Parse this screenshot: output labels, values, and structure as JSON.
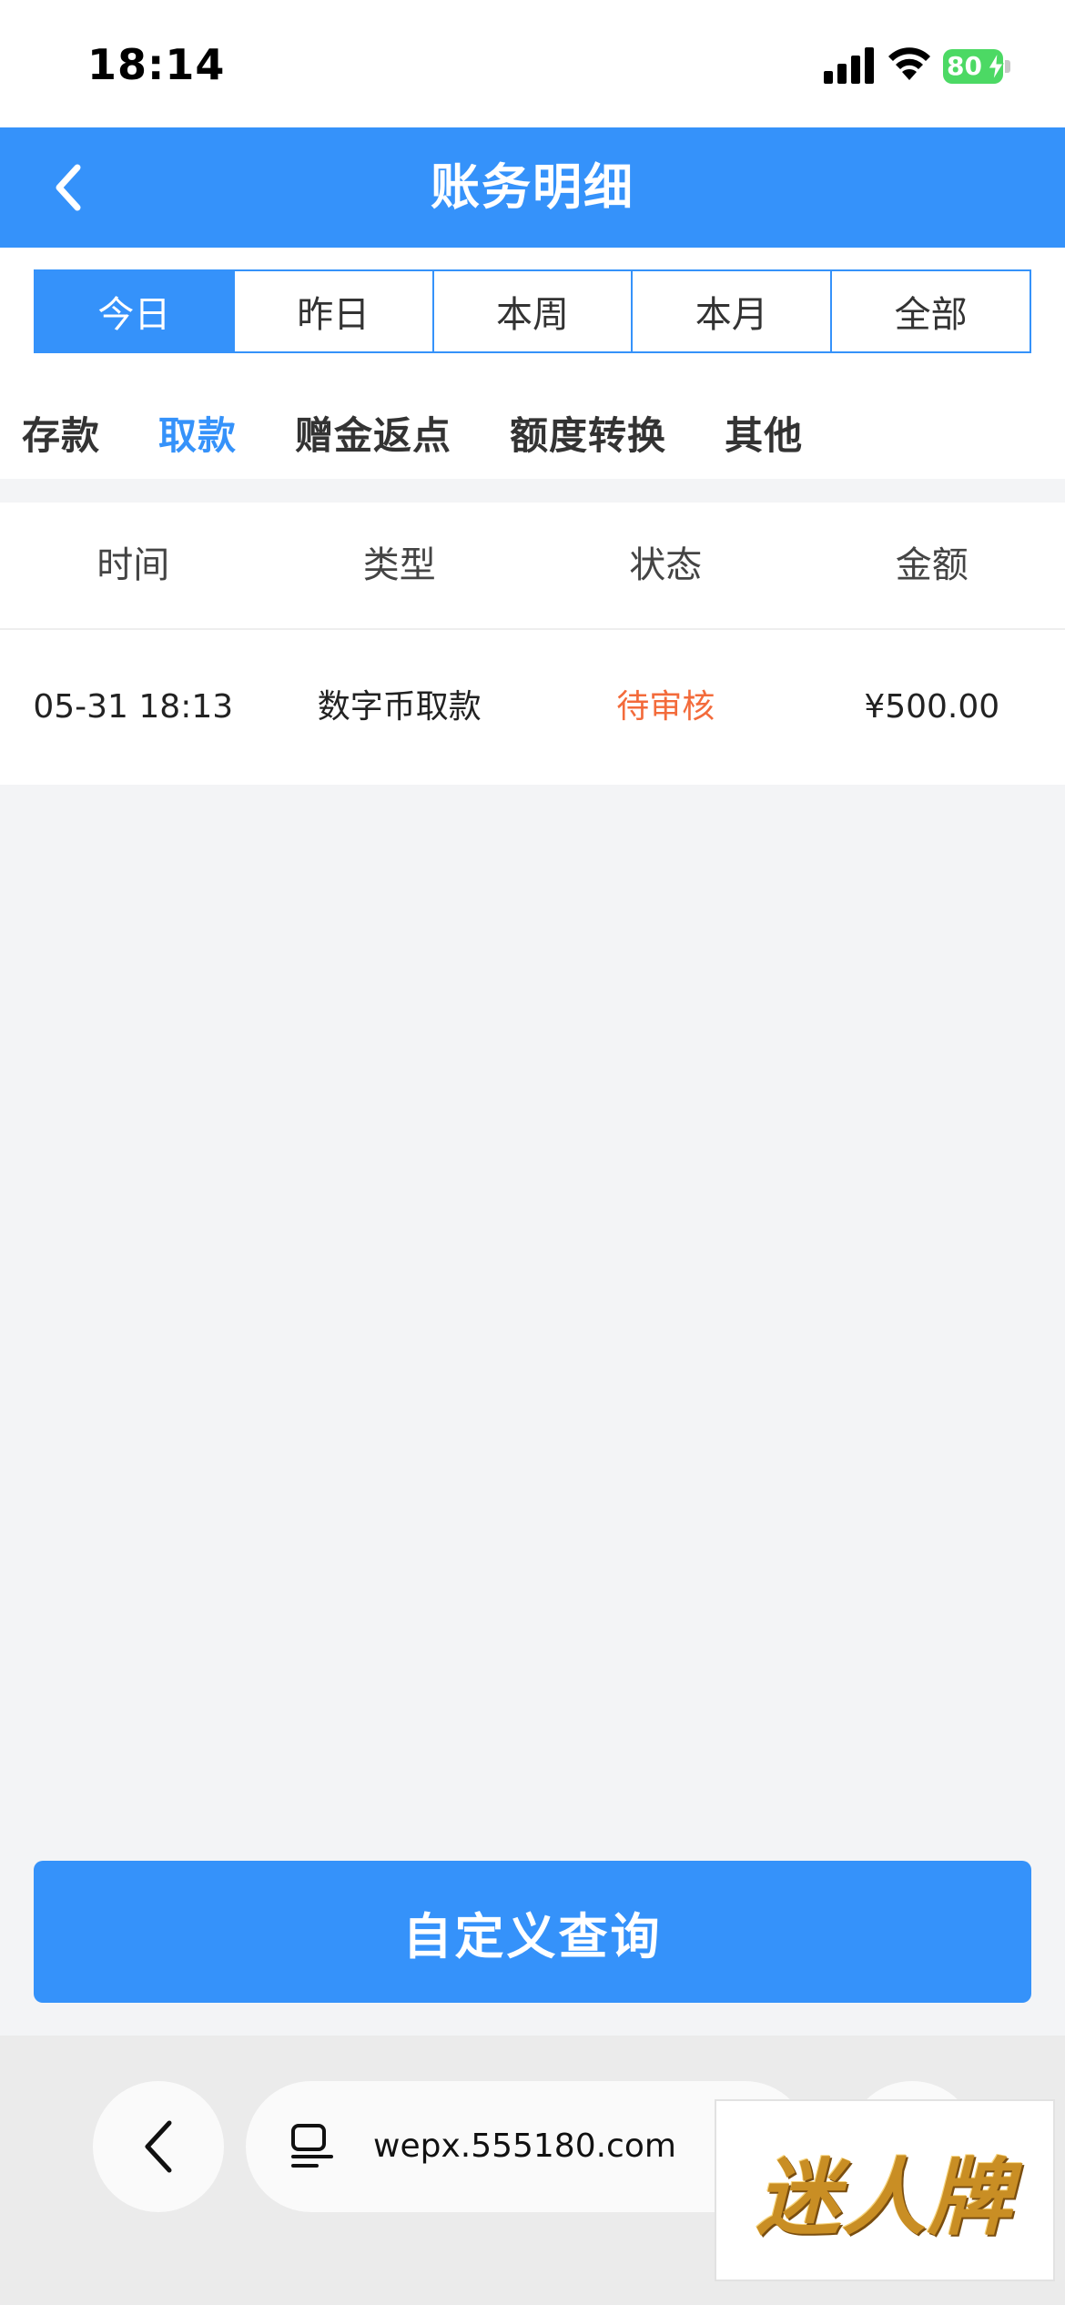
{
  "status_bar": {
    "time": "18:14",
    "battery": "80"
  },
  "header": {
    "title": "账务明细",
    "back_icon": "chevron-left-icon"
  },
  "period_filter": {
    "items": [
      "今日",
      "昨日",
      "本周",
      "本月",
      "全部"
    ],
    "active_index": 0
  },
  "type_tabs": {
    "items": [
      "存款",
      "取款",
      "赠金返点",
      "额度转换",
      "其他"
    ],
    "active_index": 1
  },
  "table": {
    "columns": [
      "时间",
      "类型",
      "状态",
      "金额"
    ],
    "rows": [
      {
        "time": "05-31 18:13",
        "type": "数字币取款",
        "status": "待审核",
        "amount": "¥500.00"
      }
    ]
  },
  "query_button": {
    "label": "自定义查询"
  },
  "browser": {
    "url": "wepx.555180.com",
    "back_icon": "chevron-left-icon",
    "tabs_icon": "tabs-icon"
  },
  "watermark": {
    "text": "迷人牌"
  },
  "colors": {
    "accent": "#3592fa",
    "status_pending": "#f36b3b",
    "battery": "#4cd964"
  }
}
